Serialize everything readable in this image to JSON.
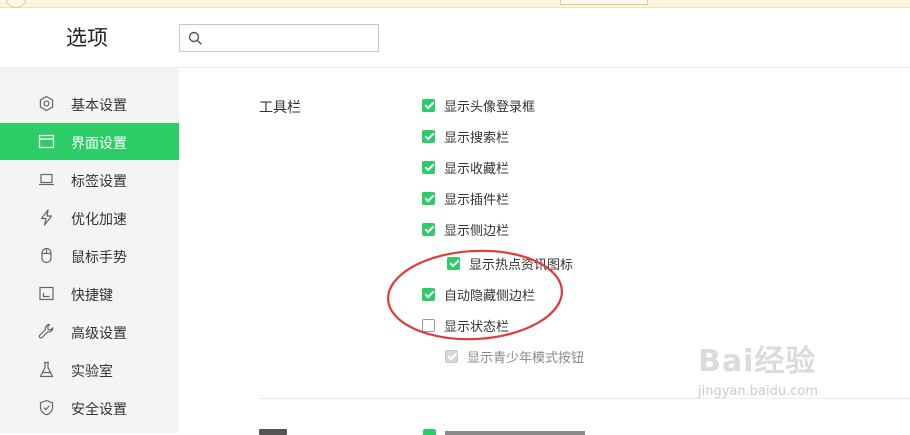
{
  "header": {
    "title": "选项",
    "search": {
      "value": "",
      "placeholder": ""
    }
  },
  "sidebar": {
    "active_index": 1,
    "items": [
      {
        "label": "基本设置",
        "icon": "gear-icon"
      },
      {
        "label": "界面设置",
        "icon": "window-icon"
      },
      {
        "label": "标签设置",
        "icon": "laptop-icon"
      },
      {
        "label": "优化加速",
        "icon": "lightning-icon"
      },
      {
        "label": "鼠标手势",
        "icon": "mouse-icon"
      },
      {
        "label": "快捷键",
        "icon": "shortcut-icon"
      },
      {
        "label": "高级设置",
        "icon": "wrench-icon"
      },
      {
        "label": "实验室",
        "icon": "flask-icon"
      },
      {
        "label": "安全设置",
        "icon": "shield-icon"
      }
    ]
  },
  "toolbar_section": {
    "title": "工具栏",
    "options": [
      {
        "label": "显示头像登录框",
        "checked": true,
        "enabled": true
      },
      {
        "label": "显示搜索栏",
        "checked": true,
        "enabled": true
      },
      {
        "label": "显示收藏栏",
        "checked": true,
        "enabled": true
      },
      {
        "label": "显示插件栏",
        "checked": true,
        "enabled": true
      },
      {
        "label": "显示侧边栏",
        "checked": true,
        "enabled": true
      },
      {
        "label": "显示热点资讯图标",
        "checked": true,
        "enabled": true,
        "indent": true
      },
      {
        "label": "自动隐藏侧边栏",
        "checked": true,
        "enabled": true
      },
      {
        "label": "显示状态栏",
        "checked": false,
        "enabled": true
      },
      {
        "label": "显示青少年模式按钮",
        "checked": true,
        "enabled": false,
        "indent": true
      }
    ]
  },
  "watermark": {
    "brand": "Bai经验",
    "url": "jingyan.baidu.com"
  },
  "colors": {
    "accent": "#2ccd67",
    "annotation": "#e03a3a",
    "sidebar_bg": "#f4f4f4"
  }
}
